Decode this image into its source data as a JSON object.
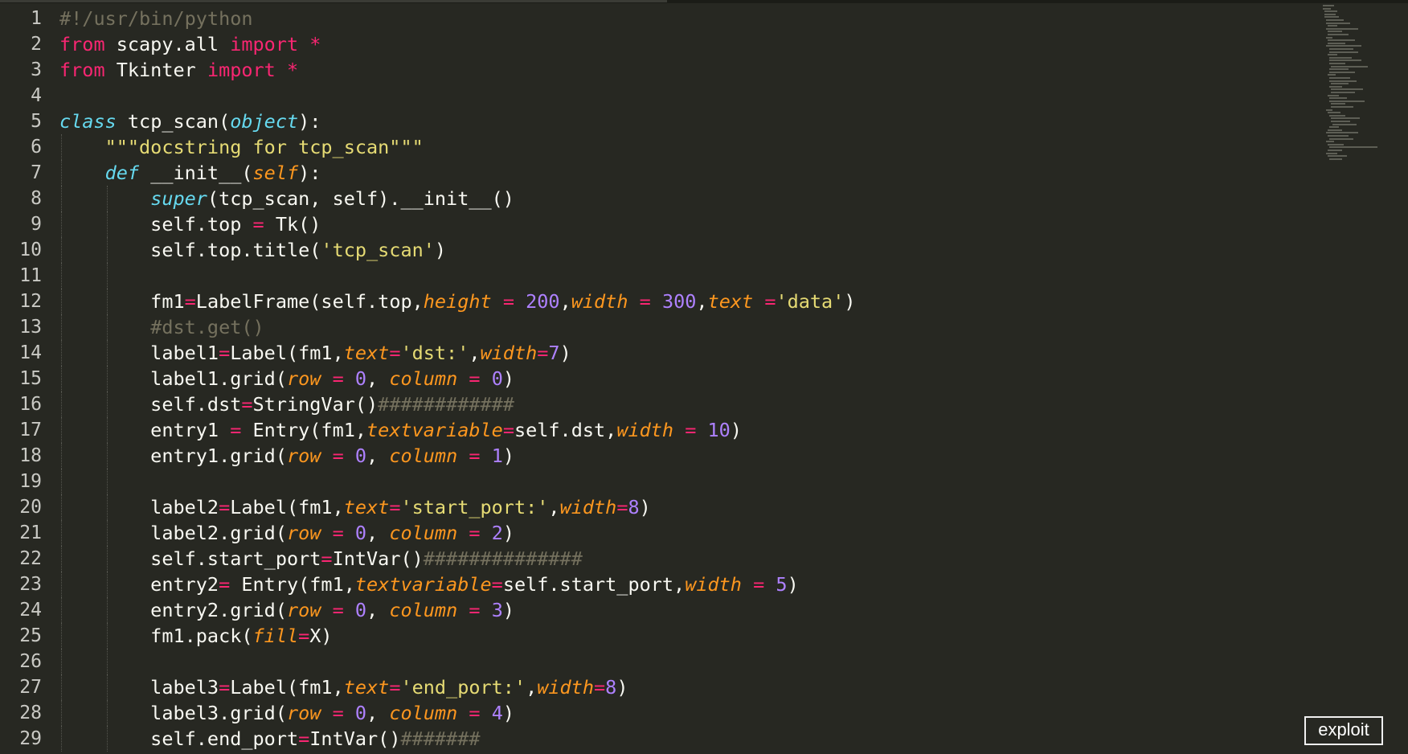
{
  "editor": {
    "lines": [
      {
        "no": "1",
        "indent": 0,
        "tokens": [
          {
            "t": "#!/usr/bin/python",
            "c": "comment"
          }
        ]
      },
      {
        "no": "2",
        "indent": 0,
        "tokens": [
          {
            "t": "from",
            "c": "keyword"
          },
          {
            "t": " scapy.all ",
            "c": "plain"
          },
          {
            "t": "import",
            "c": "keyword"
          },
          {
            "t": " ",
            "c": "plain"
          },
          {
            "t": "*",
            "c": "op"
          }
        ]
      },
      {
        "no": "3",
        "indent": 0,
        "tokens": [
          {
            "t": "from",
            "c": "keyword"
          },
          {
            "t": " Tkinter ",
            "c": "plain"
          },
          {
            "t": "import",
            "c": "keyword"
          },
          {
            "t": " ",
            "c": "plain"
          },
          {
            "t": "*",
            "c": "op"
          }
        ]
      },
      {
        "no": "4",
        "indent": 0,
        "tokens": []
      },
      {
        "no": "5",
        "indent": 0,
        "tokens": [
          {
            "t": "class",
            "c": "storage"
          },
          {
            "t": " tcp_scan(",
            "c": "plain"
          },
          {
            "t": "object",
            "c": "builtin"
          },
          {
            "t": "):",
            "c": "plain"
          }
        ]
      },
      {
        "no": "6",
        "indent": 1,
        "tokens": [
          {
            "t": "    ",
            "c": "plain"
          },
          {
            "t": "\"\"\"docstring for tcp_scan\"\"\"",
            "c": "string"
          }
        ]
      },
      {
        "no": "7",
        "indent": 1,
        "tokens": [
          {
            "t": "    ",
            "c": "plain"
          },
          {
            "t": "def",
            "c": "storage"
          },
          {
            "t": " __init__(",
            "c": "plain"
          },
          {
            "t": "self",
            "c": "param"
          },
          {
            "t": "):",
            "c": "plain"
          }
        ]
      },
      {
        "no": "8",
        "indent": 2,
        "tokens": [
          {
            "t": "        ",
            "c": "plain"
          },
          {
            "t": "super",
            "c": "builtin"
          },
          {
            "t": "(tcp_scan, self).__init__()",
            "c": "plain"
          }
        ]
      },
      {
        "no": "9",
        "indent": 2,
        "tokens": [
          {
            "t": "        self.top ",
            "c": "plain"
          },
          {
            "t": "=",
            "c": "op"
          },
          {
            "t": " Tk()",
            "c": "plain"
          }
        ]
      },
      {
        "no": "10",
        "indent": 2,
        "tokens": [
          {
            "t": "        self.top.title(",
            "c": "plain"
          },
          {
            "t": "'tcp_scan'",
            "c": "string"
          },
          {
            "t": ")",
            "c": "plain"
          }
        ]
      },
      {
        "no": "11",
        "indent": 2,
        "tokens": []
      },
      {
        "no": "12",
        "indent": 2,
        "tokens": [
          {
            "t": "        fm1",
            "c": "plain"
          },
          {
            "t": "=",
            "c": "op"
          },
          {
            "t": "LabelFrame(self.top,",
            "c": "plain"
          },
          {
            "t": "height",
            "c": "param"
          },
          {
            "t": " ",
            "c": "plain"
          },
          {
            "t": "=",
            "c": "op"
          },
          {
            "t": " ",
            "c": "plain"
          },
          {
            "t": "200",
            "c": "number"
          },
          {
            "t": ",",
            "c": "plain"
          },
          {
            "t": "width",
            "c": "param"
          },
          {
            "t": " ",
            "c": "plain"
          },
          {
            "t": "=",
            "c": "op"
          },
          {
            "t": " ",
            "c": "plain"
          },
          {
            "t": "300",
            "c": "number"
          },
          {
            "t": ",",
            "c": "plain"
          },
          {
            "t": "text",
            "c": "param"
          },
          {
            "t": " ",
            "c": "plain"
          },
          {
            "t": "=",
            "c": "op"
          },
          {
            "t": "'data'",
            "c": "string"
          },
          {
            "t": ")",
            "c": "plain"
          }
        ]
      },
      {
        "no": "13",
        "indent": 2,
        "tokens": [
          {
            "t": "        ",
            "c": "plain"
          },
          {
            "t": "#dst.get()",
            "c": "comment"
          }
        ]
      },
      {
        "no": "14",
        "indent": 2,
        "tokens": [
          {
            "t": "        label1",
            "c": "plain"
          },
          {
            "t": "=",
            "c": "op"
          },
          {
            "t": "Label(fm1,",
            "c": "plain"
          },
          {
            "t": "text",
            "c": "param"
          },
          {
            "t": "=",
            "c": "op"
          },
          {
            "t": "'dst:'",
            "c": "string"
          },
          {
            "t": ",",
            "c": "plain"
          },
          {
            "t": "width",
            "c": "param"
          },
          {
            "t": "=",
            "c": "op"
          },
          {
            "t": "7",
            "c": "number"
          },
          {
            "t": ")",
            "c": "plain"
          }
        ]
      },
      {
        "no": "15",
        "indent": 2,
        "tokens": [
          {
            "t": "        label1.grid(",
            "c": "plain"
          },
          {
            "t": "row",
            "c": "param"
          },
          {
            "t": " ",
            "c": "plain"
          },
          {
            "t": "=",
            "c": "op"
          },
          {
            "t": " ",
            "c": "plain"
          },
          {
            "t": "0",
            "c": "number"
          },
          {
            "t": ", ",
            "c": "plain"
          },
          {
            "t": "column",
            "c": "param"
          },
          {
            "t": " ",
            "c": "plain"
          },
          {
            "t": "=",
            "c": "op"
          },
          {
            "t": " ",
            "c": "plain"
          },
          {
            "t": "0",
            "c": "number"
          },
          {
            "t": ")",
            "c": "plain"
          }
        ]
      },
      {
        "no": "16",
        "indent": 2,
        "tokens": [
          {
            "t": "        self.dst",
            "c": "plain"
          },
          {
            "t": "=",
            "c": "op"
          },
          {
            "t": "StringVar()",
            "c": "plain"
          },
          {
            "t": "############",
            "c": "comment"
          }
        ]
      },
      {
        "no": "17",
        "indent": 2,
        "tokens": [
          {
            "t": "        entry1 ",
            "c": "plain"
          },
          {
            "t": "=",
            "c": "op"
          },
          {
            "t": " Entry(fm1,",
            "c": "plain"
          },
          {
            "t": "textvariable",
            "c": "param"
          },
          {
            "t": "=",
            "c": "op"
          },
          {
            "t": "self.dst,",
            "c": "plain"
          },
          {
            "t": "width",
            "c": "param"
          },
          {
            "t": " ",
            "c": "plain"
          },
          {
            "t": "=",
            "c": "op"
          },
          {
            "t": " ",
            "c": "plain"
          },
          {
            "t": "10",
            "c": "number"
          },
          {
            "t": ")",
            "c": "plain"
          }
        ]
      },
      {
        "no": "18",
        "indent": 2,
        "tokens": [
          {
            "t": "        entry1.grid(",
            "c": "plain"
          },
          {
            "t": "row",
            "c": "param"
          },
          {
            "t": " ",
            "c": "plain"
          },
          {
            "t": "=",
            "c": "op"
          },
          {
            "t": " ",
            "c": "plain"
          },
          {
            "t": "0",
            "c": "number"
          },
          {
            "t": ", ",
            "c": "plain"
          },
          {
            "t": "column",
            "c": "param"
          },
          {
            "t": " ",
            "c": "plain"
          },
          {
            "t": "=",
            "c": "op"
          },
          {
            "t": " ",
            "c": "plain"
          },
          {
            "t": "1",
            "c": "number"
          },
          {
            "t": ")",
            "c": "plain"
          }
        ]
      },
      {
        "no": "19",
        "indent": 2,
        "tokens": []
      },
      {
        "no": "20",
        "indent": 2,
        "tokens": [
          {
            "t": "        label2",
            "c": "plain"
          },
          {
            "t": "=",
            "c": "op"
          },
          {
            "t": "Label(fm1,",
            "c": "plain"
          },
          {
            "t": "text",
            "c": "param"
          },
          {
            "t": "=",
            "c": "op"
          },
          {
            "t": "'start_port:'",
            "c": "string"
          },
          {
            "t": ",",
            "c": "plain"
          },
          {
            "t": "width",
            "c": "param"
          },
          {
            "t": "=",
            "c": "op"
          },
          {
            "t": "8",
            "c": "number"
          },
          {
            "t": ")",
            "c": "plain"
          }
        ]
      },
      {
        "no": "21",
        "indent": 2,
        "tokens": [
          {
            "t": "        label2.grid(",
            "c": "plain"
          },
          {
            "t": "row",
            "c": "param"
          },
          {
            "t": " ",
            "c": "plain"
          },
          {
            "t": "=",
            "c": "op"
          },
          {
            "t": " ",
            "c": "plain"
          },
          {
            "t": "0",
            "c": "number"
          },
          {
            "t": ", ",
            "c": "plain"
          },
          {
            "t": "column",
            "c": "param"
          },
          {
            "t": " ",
            "c": "plain"
          },
          {
            "t": "=",
            "c": "op"
          },
          {
            "t": " ",
            "c": "plain"
          },
          {
            "t": "2",
            "c": "number"
          },
          {
            "t": ")",
            "c": "plain"
          }
        ]
      },
      {
        "no": "22",
        "indent": 2,
        "tokens": [
          {
            "t": "        self.start_port",
            "c": "plain"
          },
          {
            "t": "=",
            "c": "op"
          },
          {
            "t": "IntVar()",
            "c": "plain"
          },
          {
            "t": "##############",
            "c": "comment"
          }
        ]
      },
      {
        "no": "23",
        "indent": 2,
        "tokens": [
          {
            "t": "        entry2",
            "c": "plain"
          },
          {
            "t": "=",
            "c": "op"
          },
          {
            "t": " Entry(fm1,",
            "c": "plain"
          },
          {
            "t": "textvariable",
            "c": "param"
          },
          {
            "t": "=",
            "c": "op"
          },
          {
            "t": "self.start_port,",
            "c": "plain"
          },
          {
            "t": "width",
            "c": "param"
          },
          {
            "t": " ",
            "c": "plain"
          },
          {
            "t": "=",
            "c": "op"
          },
          {
            "t": " ",
            "c": "plain"
          },
          {
            "t": "5",
            "c": "number"
          },
          {
            "t": ")",
            "c": "plain"
          }
        ]
      },
      {
        "no": "24",
        "indent": 2,
        "tokens": [
          {
            "t": "        entry2.grid(",
            "c": "plain"
          },
          {
            "t": "row",
            "c": "param"
          },
          {
            "t": " ",
            "c": "plain"
          },
          {
            "t": "=",
            "c": "op"
          },
          {
            "t": " ",
            "c": "plain"
          },
          {
            "t": "0",
            "c": "number"
          },
          {
            "t": ", ",
            "c": "plain"
          },
          {
            "t": "column",
            "c": "param"
          },
          {
            "t": " ",
            "c": "plain"
          },
          {
            "t": "=",
            "c": "op"
          },
          {
            "t": " ",
            "c": "plain"
          },
          {
            "t": "3",
            "c": "number"
          },
          {
            "t": ")",
            "c": "plain"
          }
        ]
      },
      {
        "no": "25",
        "indent": 2,
        "tokens": [
          {
            "t": "        fm1.pack(",
            "c": "plain"
          },
          {
            "t": "fill",
            "c": "param"
          },
          {
            "t": "=",
            "c": "op"
          },
          {
            "t": "X)",
            "c": "plain"
          }
        ]
      },
      {
        "no": "26",
        "indent": 2,
        "tokens": []
      },
      {
        "no": "27",
        "indent": 2,
        "tokens": [
          {
            "t": "        label3",
            "c": "plain"
          },
          {
            "t": "=",
            "c": "op"
          },
          {
            "t": "Label(fm1,",
            "c": "plain"
          },
          {
            "t": "text",
            "c": "param"
          },
          {
            "t": "=",
            "c": "op"
          },
          {
            "t": "'end_port:'",
            "c": "string"
          },
          {
            "t": ",",
            "c": "plain"
          },
          {
            "t": "width",
            "c": "param"
          },
          {
            "t": "=",
            "c": "op"
          },
          {
            "t": "8",
            "c": "number"
          },
          {
            "t": ")",
            "c": "plain"
          }
        ]
      },
      {
        "no": "28",
        "indent": 2,
        "tokens": [
          {
            "t": "        label3.grid(",
            "c": "plain"
          },
          {
            "t": "row",
            "c": "param"
          },
          {
            "t": " ",
            "c": "plain"
          },
          {
            "t": "=",
            "c": "op"
          },
          {
            "t": " ",
            "c": "plain"
          },
          {
            "t": "0",
            "c": "number"
          },
          {
            "t": ", ",
            "c": "plain"
          },
          {
            "t": "column",
            "c": "param"
          },
          {
            "t": " ",
            "c": "plain"
          },
          {
            "t": "=",
            "c": "op"
          },
          {
            "t": " ",
            "c": "plain"
          },
          {
            "t": "4",
            "c": "number"
          },
          {
            "t": ")",
            "c": "plain"
          }
        ]
      },
      {
        "no": "29",
        "indent": 2,
        "tokens": [
          {
            "t": "        self.end_port",
            "c": "plain"
          },
          {
            "t": "=",
            "c": "op"
          },
          {
            "t": "IntVar()",
            "c": "plain"
          },
          {
            "t": "#######",
            "c": "comment"
          }
        ]
      }
    ]
  },
  "overlay_button": {
    "label": "exploit"
  },
  "colors": {
    "background": "#272822",
    "foreground": "#f8f8f2",
    "keyword": "#f92672",
    "storage": "#66d9ef",
    "parameter": "#fd971f",
    "string": "#e6db74",
    "number": "#ae81ff",
    "comment": "#75715e"
  }
}
